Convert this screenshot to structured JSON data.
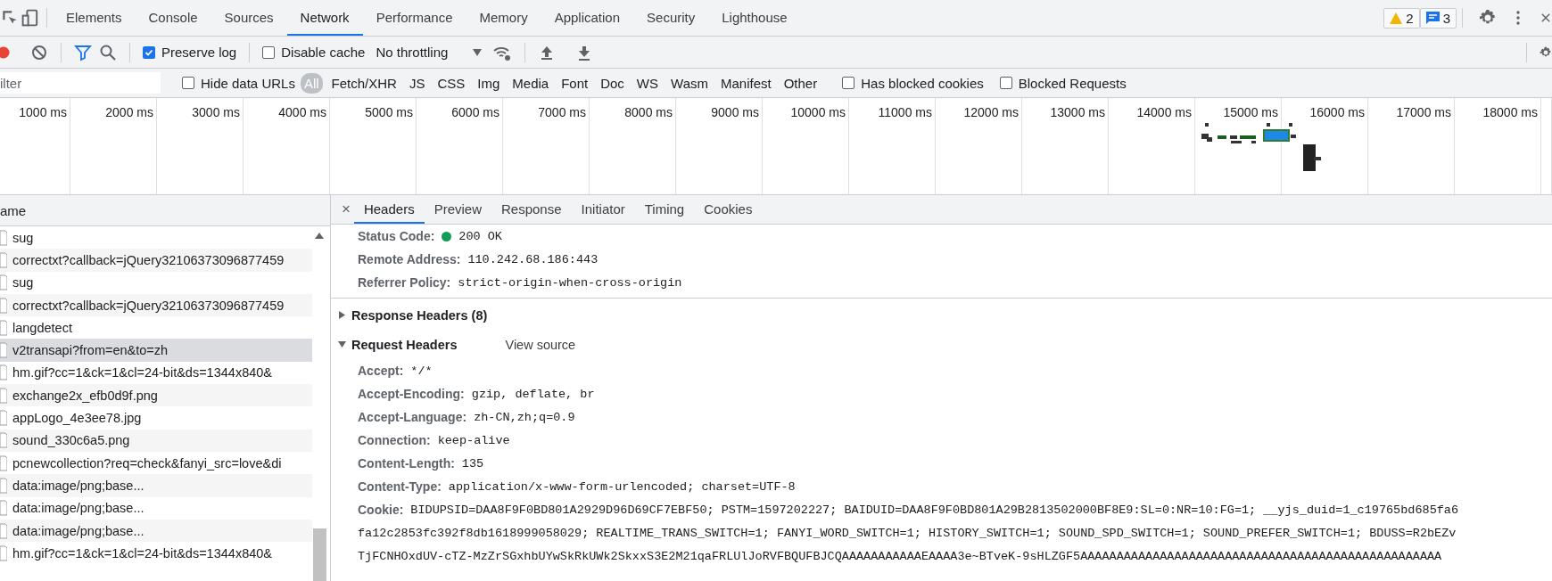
{
  "main_tabs": [
    {
      "label": "Elements",
      "selected": false
    },
    {
      "label": "Console",
      "selected": false
    },
    {
      "label": "Sources",
      "selected": false
    },
    {
      "label": "Network",
      "selected": true
    },
    {
      "label": "Performance",
      "selected": false
    },
    {
      "label": "Memory",
      "selected": false
    },
    {
      "label": "Application",
      "selected": false
    },
    {
      "label": "Security",
      "selected": false
    },
    {
      "label": "Lighthouse",
      "selected": false
    }
  ],
  "issue_badges": [
    {
      "kind": "warning",
      "count": "2"
    },
    {
      "kind": "message",
      "count": "3"
    }
  ],
  "toolbar": {
    "recording": true,
    "preserve_log": {
      "label": "Preserve log",
      "checked": true
    },
    "disable_cache": {
      "label": "Disable cache",
      "checked": false
    },
    "throttling": "No throttling"
  },
  "filter": {
    "placeholder": "ilter",
    "hide_data_urls": {
      "label": "Hide data URLs",
      "checked": false
    },
    "types": [
      {
        "label": "All",
        "selected": true
      },
      {
        "label": "Fetch/XHR",
        "selected": false
      },
      {
        "label": "JS",
        "selected": false
      },
      {
        "label": "CSS",
        "selected": false
      },
      {
        "label": "Img",
        "selected": false
      },
      {
        "label": "Media",
        "selected": false
      },
      {
        "label": "Font",
        "selected": false
      },
      {
        "label": "Doc",
        "selected": false
      },
      {
        "label": "WS",
        "selected": false
      },
      {
        "label": "Wasm",
        "selected": false
      },
      {
        "label": "Manifest",
        "selected": false
      },
      {
        "label": "Other",
        "selected": false
      }
    ],
    "has_blocked_cookies": {
      "label": "Has blocked cookies",
      "checked": false
    },
    "blocked_requests": {
      "label": "Blocked Requests",
      "checked": false
    }
  },
  "timeline": {
    "ticks": [
      "1000 ms",
      "2000 ms",
      "3000 ms",
      "4000 ms",
      "5000 ms",
      "6000 ms",
      "7000 ms",
      "8000 ms",
      "9000 ms",
      "10000 ms",
      "11000 ms",
      "12000 ms",
      "13000 ms",
      "14000 ms",
      "15000 ms",
      "16000 ms",
      "17000 ms",
      "18000 ms"
    ]
  },
  "requests": {
    "column": "ame",
    "rows": [
      {
        "name": "sug",
        "selected": false
      },
      {
        "name": "correctxt?callback=jQuery32106373096877459",
        "selected": false
      },
      {
        "name": "sug",
        "selected": false
      },
      {
        "name": "correctxt?callback=jQuery32106373096877459",
        "selected": false
      },
      {
        "name": "langdetect",
        "selected": false
      },
      {
        "name": "v2transapi?from=en&to=zh",
        "selected": true
      },
      {
        "name": "hm.gif?cc=1&ck=1&cl=24-bit&ds=1344x840&",
        "selected": false
      },
      {
        "name": "exchange2x_efb0d9f.png",
        "selected": false
      },
      {
        "name": "appLogo_4e3ee78.jpg",
        "selected": false
      },
      {
        "name": "sound_330c6a5.png",
        "selected": false
      },
      {
        "name": "pcnewcollection?req=check&fanyi_src=love&di",
        "selected": false
      },
      {
        "name": "data:image/png;base...",
        "selected": false
      },
      {
        "name": "data:image/png;base...",
        "selected": false
      },
      {
        "name": "data:image/png;base...",
        "selected": false
      },
      {
        "name": "hm.gif?cc=1&ck=1&cl=24-bit&ds=1344x840&",
        "selected": false
      }
    ]
  },
  "details": {
    "close": "×",
    "tabs": [
      {
        "label": "Headers",
        "selected": true
      },
      {
        "label": "Preview",
        "selected": false
      },
      {
        "label": "Response",
        "selected": false
      },
      {
        "label": "Initiator",
        "selected": false
      },
      {
        "label": "Timing",
        "selected": false
      },
      {
        "label": "Cookies",
        "selected": false
      }
    ],
    "general": [
      {
        "kind": "status",
        "name": "Status Code:",
        "value": "200 OK"
      },
      {
        "kind": "plain",
        "name": "Remote Address:",
        "value": "110.242.68.186:443"
      },
      {
        "kind": "plain",
        "name": "Referrer Policy:",
        "value": "strict-origin-when-cross-origin"
      }
    ],
    "sections": [
      {
        "title": "Response Headers (8)",
        "expanded": false
      },
      {
        "title": "Request Headers",
        "expanded": true,
        "link": "View source",
        "headers": [
          {
            "name": "Accept:",
            "lines": [
              "*/*"
            ]
          },
          {
            "name": "Accept-Encoding:",
            "lines": [
              "gzip, deflate, br"
            ]
          },
          {
            "name": "Accept-Language:",
            "lines": [
              "zh-CN,zh;q=0.9"
            ]
          },
          {
            "name": "Connection:",
            "lines": [
              "keep-alive"
            ]
          },
          {
            "name": "Content-Length:",
            "lines": [
              "135"
            ]
          },
          {
            "name": "Content-Type:",
            "lines": [
              "application/x-www-form-urlencoded; charset=UTF-8"
            ]
          },
          {
            "name": "Cookie:",
            "lines": [
              "BIDUPSID=DAA8F9F0BD801A2929D96D69CF7EBF50; PSTM=1597202227; BAIDUID=DAA8F9F0BD801A29B2813502000BF8E9:SL=0:NR=10:FG=1; __yjs_duid=1_c19765bd685fa6",
              "fa12c2853fc392f8db1618999058029; REALTIME_TRANS_SWITCH=1; FANYI_WORD_SWITCH=1; HISTORY_SWITCH=1; SOUND_SPD_SWITCH=1; SOUND_PREFER_SWITCH=1; BDUSS=R2bEZv",
              "TjFCNHOxdUV-cTZ-MzZrSGxhbUYwSkRkUWk2SkxxS3E2M21qaFRLUlJoRVFBQUFBJCQAAAAAAAAAAAEAAAA3e~BTveK-9sHLZGF5AAAAAAAAAAAAAAAAAAAAAAAAAAAAAAAAAAAAAAAAAAAAAAAAAA"
            ]
          }
        ]
      }
    ]
  }
}
